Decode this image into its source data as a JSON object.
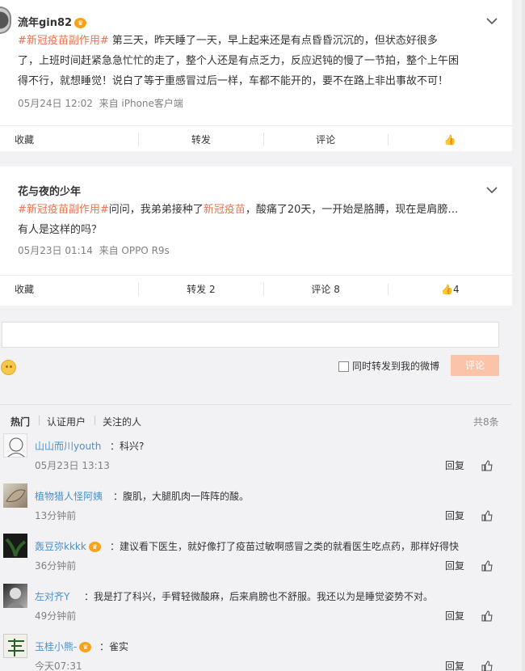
{
  "posts": [
    {
      "user": "流年gin82",
      "topic": "#新冠疫苗副作用#",
      "body_lines": [
        " 第三天，昨天睡了一天，早上起来还是有点昏昏沉沉的，但状态好很多",
        "了，上班时间赶紧急急忙忙的走了，整个人还是有点乏力，反应迟钝的慢了一节拍，整个上午困",
        "得不行，就想睡觉！说白了等于重感冒过后一样，车都不能开的，要不在路上非出事故不可！"
      ],
      "time": "05月24日 12:02",
      "source": "来自 iPhone客户端",
      "actions": {
        "favorite": "收藏",
        "repost": "转发",
        "comment": "评论",
        "like": ""
      }
    },
    {
      "user": "花与夜的少年",
      "topic": "#新冠疫苗副作用#",
      "body_before_link": "问问，我弟弟接种了",
      "link": "新冠疫苗",
      "body_after_link": "，酸痛了20天，一开始是胳膊，现在是肩膀…",
      "body_line2": "有人是这样的吗？",
      "time": "05月23日 01:14",
      "source": "来自 OPPO R9s",
      "actions": {
        "favorite": "收藏",
        "repost": "转发 2",
        "comment": "评论 8",
        "like": "4"
      }
    }
  ],
  "composer": {
    "forward_label": "同时转发到我的微博",
    "submit": "评论"
  },
  "filters": {
    "hot": "热门",
    "verified": "认证用户",
    "following": "关注的人",
    "total": "共8条"
  },
  "comments": [
    {
      "user": "山山而川youth",
      "vip": false,
      "text": "：科兴?",
      "time": "05月23日 13:13",
      "reply": "回复"
    },
    {
      "user": "植物猎人怪阿姨",
      "vip": false,
      "text": "：腹肌，大腿肌肉一阵阵的酸。",
      "time": "13分钟前",
      "reply": "回复"
    },
    {
      "user": "轰豆弥kkkk",
      "vip": true,
      "text": "：建议看下医生，就好像打了疫苗过敏啊感冒之类的就看医生吃点药，那样好得快",
      "time": "36分钟前",
      "reply": "回复"
    },
    {
      "user": "左对齐Y",
      "vip": false,
      "text": "：我是打了科兴，手臂轻微酸麻，后来肩膀也不舒服。我还以为是睡觉姿势不对。",
      "time": "49分钟前",
      "reply": "回复"
    },
    {
      "user": "玉桂小熊-",
      "vip": true,
      "text": "：雀实",
      "time": "今天07:31",
      "reply": "回复"
    }
  ]
}
